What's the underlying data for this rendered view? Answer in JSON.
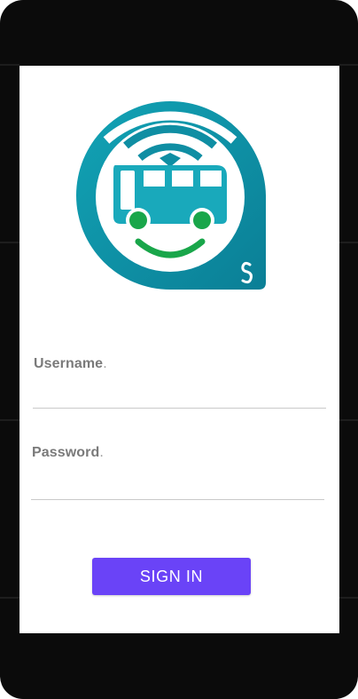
{
  "form": {
    "username_label": "Username",
    "username_value": "",
    "password_label": "Password",
    "password_value": "",
    "label_suffix": "."
  },
  "actions": {
    "signin_label": "SIGN IN"
  },
  "icons": {
    "app_logo": "bus-logo-icon"
  },
  "colors": {
    "button": "#6a43f7",
    "logo_teal": "#0f93a8",
    "logo_green": "#19a64a",
    "frame": "#0b0b0b"
  }
}
